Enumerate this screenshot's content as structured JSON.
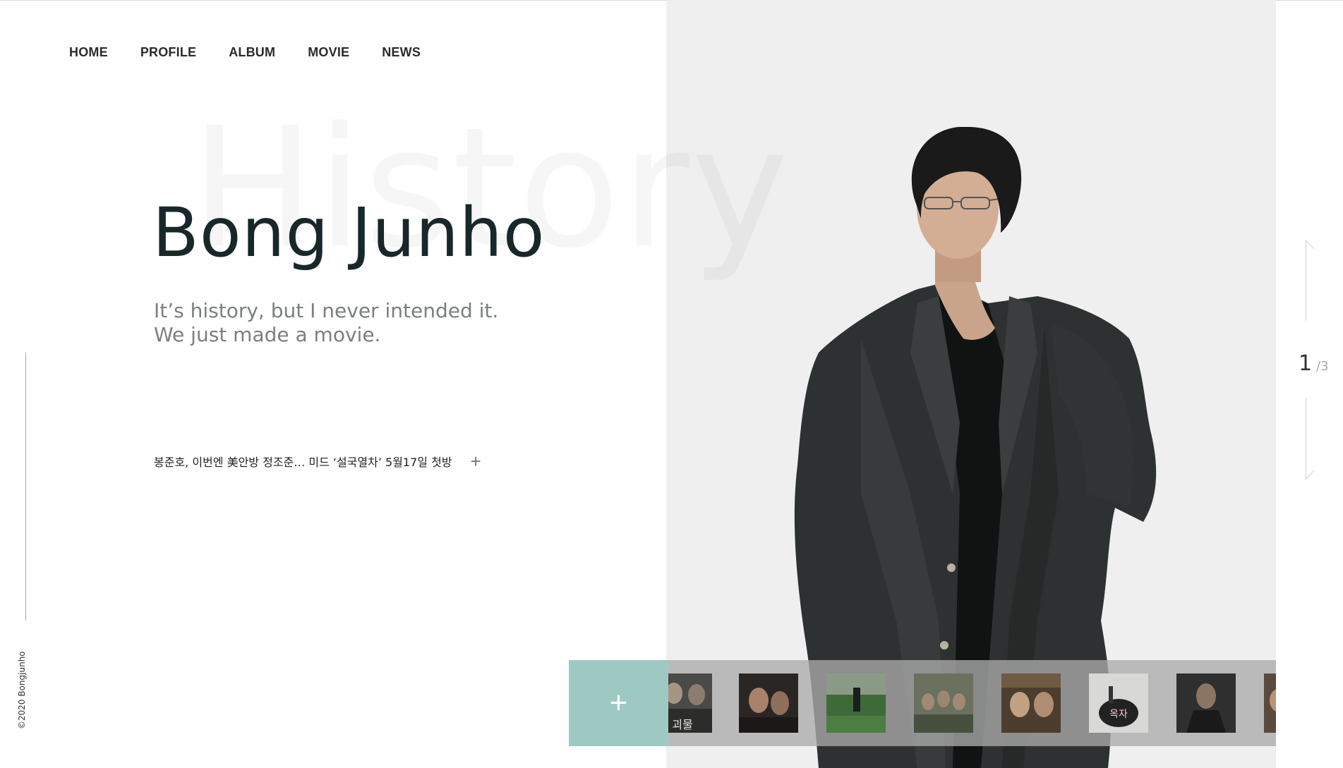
{
  "nav": {
    "items": [
      {
        "label": "HOME"
      },
      {
        "label": "PROFILE"
      },
      {
        "label": "ALBUM"
      },
      {
        "label": "MOVIE"
      },
      {
        "label": "NEWS"
      }
    ]
  },
  "hero": {
    "watermark": "History",
    "title": "Bong Junho",
    "quote_line1": "It’s history, but I never intended it.",
    "quote_line2": "We just made a movie."
  },
  "news": {
    "headline": "봉준호, 이번엔 美안방 정조준… 미드 ‘설국열차’ 5월17일 첫방",
    "more_icon": "plus-icon"
  },
  "footer": {
    "copyright": "©2020 Bongjunho"
  },
  "pager": {
    "current": "1",
    "total": "/3"
  },
  "strip": {
    "add_icon": "plus-icon",
    "thumbnails": [
      {
        "caption": "괴물"
      },
      {
        "caption": ""
      },
      {
        "caption": ""
      },
      {
        "caption": ""
      },
      {
        "caption": ""
      },
      {
        "caption": "옥자"
      },
      {
        "caption": ""
      },
      {
        "caption": ""
      }
    ]
  },
  "colors": {
    "panel": "#efefef",
    "accent": "#9ec9c3",
    "title": "#17272a",
    "strip": "#aaaaaa"
  }
}
